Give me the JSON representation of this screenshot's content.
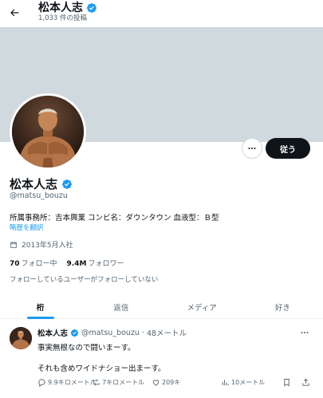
{
  "header": {
    "title": "松本人志",
    "post_count": "1,033 件の投稿"
  },
  "profile": {
    "name": "松本人志",
    "handle": "@matsu_bouzu",
    "bio": "所属事務所：吉本興業 コンビ名：ダウンタウン 血液型：Ｂ型",
    "translate_label": "略歴を翻訳",
    "joined": "2013年5月入社",
    "following_count": "70",
    "following_label": "フォロー中",
    "followers_count": "9.4M",
    "followers_label": "フォロワー",
    "mutual_note": "フォローしているユーザーがフォローしていない",
    "follow_button": "従う"
  },
  "tabs": [
    {
      "label": "桁"
    },
    {
      "label": "返信"
    },
    {
      "label": "メディア"
    },
    {
      "label": "好き"
    }
  ],
  "tweet": {
    "name": "松本人志",
    "handle": "@matsu_bouzu",
    "separator": "·",
    "time": "48メートル",
    "line1": "事実無根なので闘いまーす。",
    "line2": "それも含めワイドナショー出まーす。",
    "replies": "9.9キロメートル",
    "retweets": "7キロメートル",
    "likes": "209キ",
    "views": "10メートル"
  },
  "colors": {
    "accent": "#1d9bf0",
    "banner": "#cfd9de",
    "text": "#0f1419",
    "secondary": "#536471"
  }
}
